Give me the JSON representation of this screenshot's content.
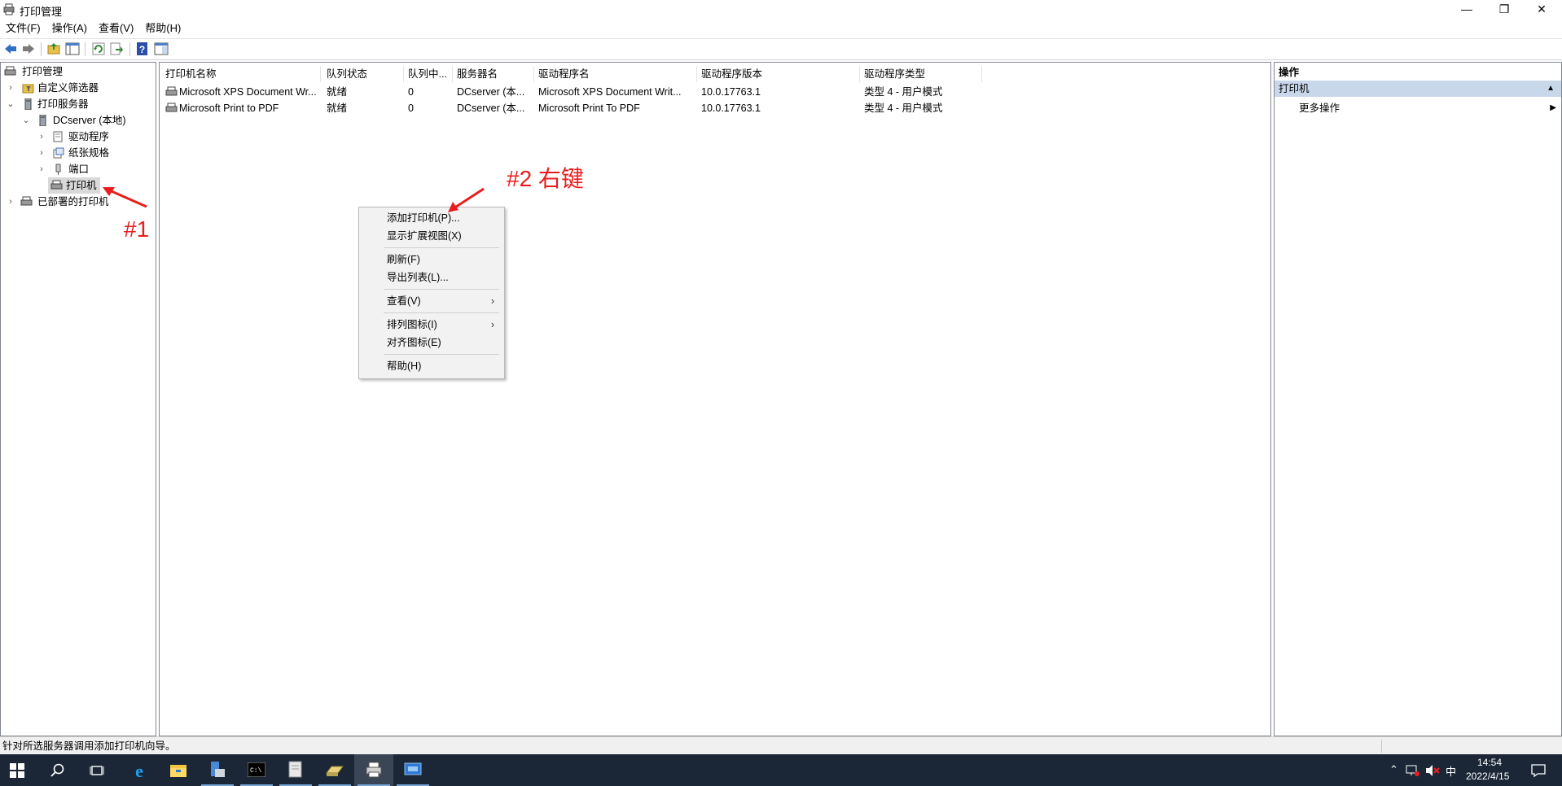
{
  "window": {
    "title": "打印管理",
    "controls": {
      "minimize": "—",
      "restore": "❐",
      "close": "✕"
    }
  },
  "menubar": {
    "items": [
      "文件(F)",
      "操作(A)",
      "查看(V)",
      "帮助(H)"
    ]
  },
  "toolbar": {
    "icons": [
      "back-icon",
      "forward-icon",
      "up-folder-icon",
      "show-hide-tree-icon",
      "refresh-icon",
      "export-icon",
      "help-icon",
      "properties-icon"
    ]
  },
  "tree": {
    "root": "打印管理",
    "custom_filters": "自定义筛选器",
    "print_servers": "打印服务器",
    "server": "DCserver (本地)",
    "drivers": "驱动程序",
    "forms": "纸张规格",
    "ports": "端口",
    "printers": "打印机",
    "deployed": "已部署的打印机"
  },
  "list": {
    "columns": [
      "打印机名称",
      "队列状态",
      "队列中...",
      "服务器名",
      "驱动程序名",
      "驱动程序版本",
      "驱动程序类型"
    ],
    "rows": [
      [
        "Microsoft XPS Document Wr...",
        "就绪",
        "0",
        "DCserver (本...",
        "Microsoft XPS Document Writ...",
        "10.0.17763.1",
        "类型 4 - 用户模式"
      ],
      [
        "Microsoft Print to PDF",
        "就绪",
        "0",
        "DCserver (本...",
        "Microsoft Print To PDF",
        "10.0.17763.1",
        "类型 4 - 用户模式"
      ]
    ]
  },
  "context_menu": {
    "add_printer": "添加打印机(P)...",
    "show_extended": "显示扩展视图(X)",
    "refresh": "刷新(F)",
    "export_list": "导出列表(L)...",
    "view": "查看(V)",
    "arrange_icons": "排列图标(I)",
    "align_icons": "对齐图标(E)",
    "help": "帮助(H)",
    "submenu_arrow": "›"
  },
  "actions": {
    "header": "操作",
    "section": "打印机",
    "more_actions": "更多操作",
    "collapse_glyph": "▲",
    "expand_glyph": "▶"
  },
  "statusbar": {
    "text": "针对所选服务器调用添加打印机向导。"
  },
  "annotations": {
    "step1": "#1",
    "step2": "#2 右键"
  },
  "taskbar": {
    "ime": "中",
    "time": "14:54",
    "date": "2022/4/15"
  },
  "colors": {
    "annotation": "#e81e1e",
    "taskbar": "#1b2736",
    "selection": "#d9d9d9",
    "action_section": "#c9d7ea"
  }
}
